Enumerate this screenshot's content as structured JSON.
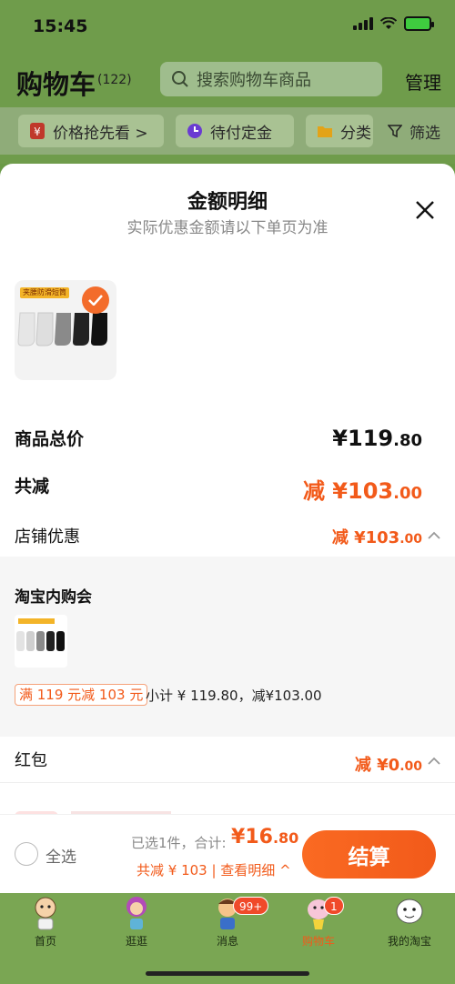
{
  "status_bar": {
    "time": "15:45"
  },
  "header": {
    "title": "购物车",
    "count": "(122)",
    "search_placeholder": "搜索购物车商品",
    "manage_label": "管理"
  },
  "chips": [
    {
      "label": "价格抢先看 >"
    },
    {
      "label": "待付定金"
    },
    {
      "label": "分类"
    },
    {
      "label": "筛选"
    }
  ],
  "sheet": {
    "title": "金额明细",
    "subtitle": "实际优惠金额请以下单页为准",
    "product_thumb_caption": "夹腰防滑短筒",
    "total_label": "商品总价",
    "total_currency": "¥",
    "total_int": "119",
    "total_dec": ".80",
    "reduce_label": "共减",
    "reduce_prefix": "减 ¥",
    "reduce_int": "103",
    "reduce_dec": ".00",
    "shop_discount_label": "店铺优惠",
    "shop_discount_prefix": "减 ¥",
    "shop_discount_int": "103",
    "shop_discount_dec": ".00",
    "shop_name": "淘宝内购会",
    "promo_tag": "满 119 元减 103 元",
    "subtotal_text": "小计 ¥ 119.80，减¥103.00",
    "redpack_label": "红包",
    "redpack_prefix": "减 ¥",
    "redpack_int": "0",
    "redpack_dec": ".00"
  },
  "bottom_bar": {
    "select_all": "全选",
    "chosen_text": "已选1件，合计:",
    "chosen_currency": "¥",
    "chosen_int": "16",
    "chosen_dec": ".80",
    "reduce_line": "共减 ¥ 103 | 查看明细 ^",
    "checkout_label": "结算"
  },
  "tabs": [
    {
      "label": "首页"
    },
    {
      "label": "逛逛"
    },
    {
      "label": "消息",
      "badge": "99+"
    },
    {
      "label": "购物车",
      "badge": "1"
    },
    {
      "label": "我的淘宝"
    }
  ],
  "colors": {
    "accent": "#f25a1a",
    "header_bg": "#6f9c4b",
    "tab_bg": "#7aa653"
  }
}
